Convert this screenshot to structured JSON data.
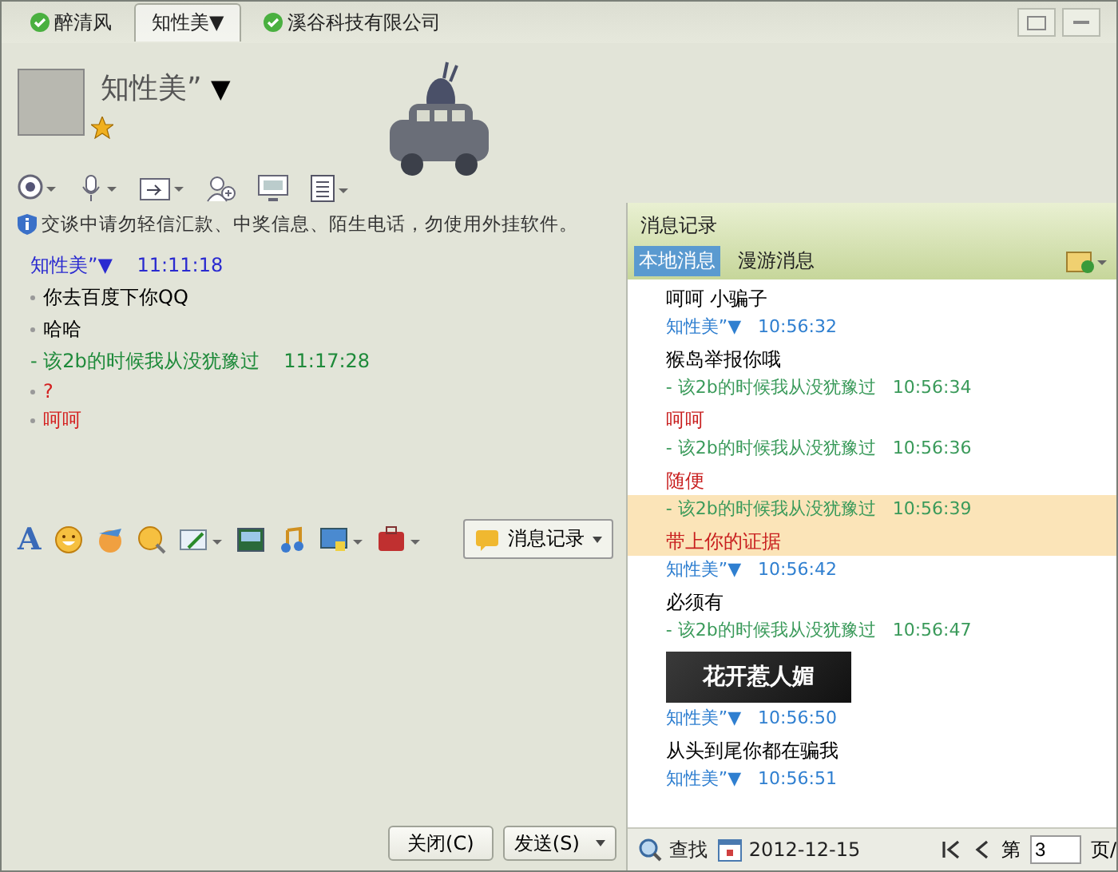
{
  "tabs": [
    {
      "label": "醉清风",
      "selected": false,
      "online": true
    },
    {
      "label": "知性美",
      "caret": "▼",
      "selected": true,
      "online": false
    },
    {
      "label": "溪谷科技有限公司",
      "selected": false,
      "online": true
    }
  ],
  "contact": {
    "name": "知性美”",
    "caret": "▼"
  },
  "notice": "交谈中请勿轻信汇款、中奖信息、陌生电话，勿使用外挂软件。",
  "chat": [
    {
      "kind": "sender",
      "name": "知性美”",
      "caret": "▼",
      "time": "11:11:18",
      "color": "#2a2ad0"
    },
    {
      "kind": "message",
      "text": "你去百度下你QQ",
      "color": "#000000"
    },
    {
      "kind": "message",
      "text": "哈哈",
      "color": "#000000"
    },
    {
      "kind": "sender",
      "name": "- 该2b的时候我从没犹豫过",
      "time": "11:17:28",
      "color": "#1e8a3a"
    },
    {
      "kind": "message",
      "text": "?",
      "color": "#d42020"
    },
    {
      "kind": "message",
      "text": "呵呵",
      "color": "#d42020"
    }
  ],
  "font_icon": "A",
  "history_button": "消息记录",
  "buttons": [
    {
      "label": "关闭(C)",
      "dropdown": false
    },
    {
      "label": "发送(S)",
      "dropdown": true
    }
  ],
  "history": {
    "title": "消息记录",
    "tabs": [
      {
        "label": "本地消息",
        "selected": true
      },
      {
        "label": "漫游消息",
        "selected": false
      }
    ],
    "items": [
      {
        "kind": "message",
        "text": "呵呵 小骗子",
        "color": "#000000",
        "highlighted": false
      },
      {
        "kind": "sender",
        "name": "知性美”",
        "caret": "▼",
        "time": "10:56:32",
        "color": "#2f7fd0",
        "highlighted": false
      },
      {
        "kind": "message",
        "text": "猴岛举报你哦",
        "color": "#000000",
        "highlighted": false
      },
      {
        "kind": "sender",
        "name": "- 该2b的时候我从没犹豫过",
        "time": "10:56:34",
        "color": "#3a9a5a",
        "highlighted": false
      },
      {
        "kind": "message",
        "text": "呵呵",
        "color": "#c81e1e",
        "highlighted": false
      },
      {
        "kind": "sender",
        "name": "- 该2b的时候我从没犹豫过",
        "time": "10:56:36",
        "color": "#3a9a5a",
        "highlighted": false
      },
      {
        "kind": "message",
        "text": "随便",
        "color": "#c81e1e",
        "highlighted": false
      },
      {
        "kind": "sender",
        "name": "- 该2b的时候我从没犹豫过",
        "time": "10:56:39",
        "color": "#3a9a5a",
        "highlighted": true
      },
      {
        "kind": "message",
        "text": "带上你的证据",
        "color": "#c81e1e",
        "highlighted": true
      },
      {
        "kind": "sender",
        "name": "知性美”",
        "caret": "▼",
        "time": "10:56:42",
        "color": "#2f7fd0",
        "highlighted": false
      },
      {
        "kind": "message",
        "text": "必须有",
        "color": "#000000",
        "highlighted": false
      },
      {
        "kind": "sender",
        "name": "- 该2b的时候我从没犹豫过",
        "time": "10:56:47",
        "color": "#3a9a5a",
        "highlighted": false
      },
      {
        "kind": "image",
        "text": "花开惹人媚",
        "highlighted": false
      },
      {
        "kind": "sender",
        "name": "知性美”",
        "caret": "▼",
        "time": "10:56:50",
        "color": "#2f7fd0",
        "highlighted": false
      },
      {
        "kind": "message",
        "text": "从头到尾你都在骗我",
        "color": "#000000",
        "highlighted": false
      },
      {
        "kind": "sender",
        "name": "知性美”",
        "caret": "▼",
        "time": "10:56:51",
        "color": "#2f7fd0",
        "highlighted": false
      }
    ],
    "search": "查找",
    "date": "2012-12-15",
    "page_label": "第",
    "page": "3",
    "page_suffix": "页/"
  }
}
